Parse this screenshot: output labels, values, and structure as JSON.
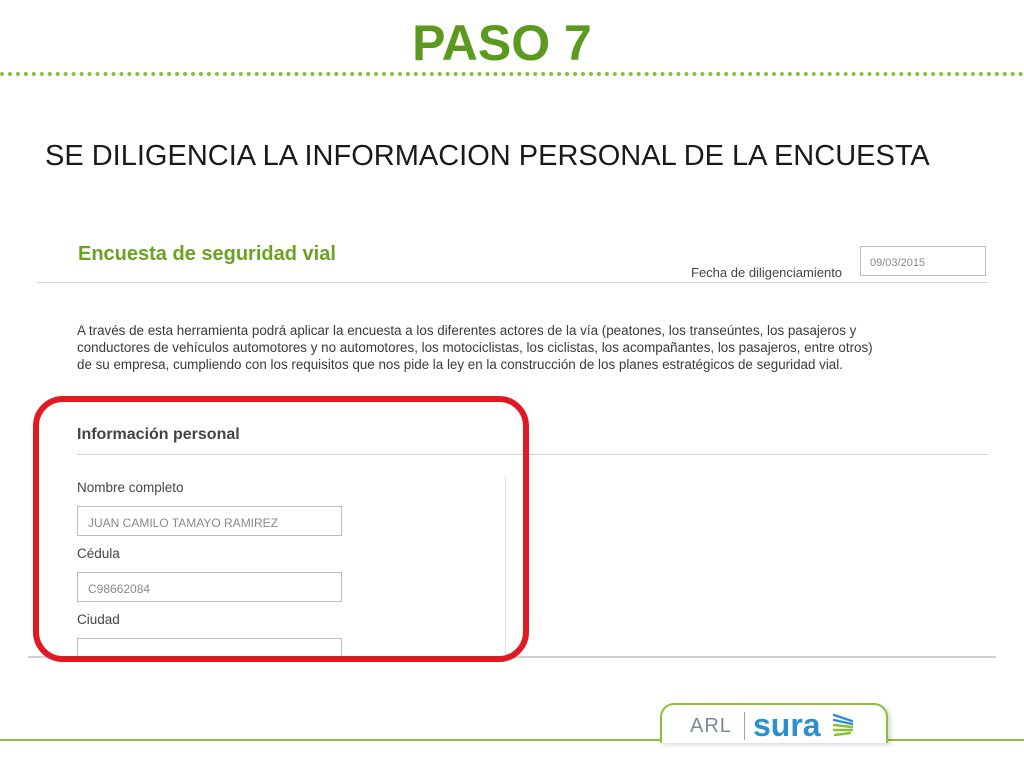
{
  "slide": {
    "title": "PASO 7",
    "subtitle": "SE DILIGENCIA LA INFORMACION PERSONAL DE LA ENCUESTA"
  },
  "form": {
    "title": "Encuesta de seguridad vial",
    "date_value": "09/03/2015",
    "date_label": "Fecha de diligenciamiento",
    "intro_lines": [
      "A través de esta herramienta podrá aplicar la encuesta a los diferentes actores de la vía (peatones, los transeúntes, los pasajeros y",
      "conductores de vehículos automotores y no automotores, los motociclistas, los ciclistas, los acompañantes, los pasajeros, entre otros)",
      "de su empresa, cumpliendo con los requisitos que nos pide la ley en la construcción de los planes estratégicos de seguridad vial."
    ],
    "section_title": "Información personal",
    "fields": {
      "nombre": {
        "label": "Nombre completo",
        "value": "JUAN CAMILO TAMAYO RAMIREZ"
      },
      "cedula": {
        "label": "Cédula",
        "value": "C98662084"
      },
      "ciudad": {
        "label": "Ciudad",
        "value": ""
      }
    }
  },
  "logo": {
    "arl": "ARL",
    "brand": "sura",
    "icon": "sura-wing-icon"
  },
  "colors": {
    "title_green": "#5c9a1f",
    "form_green": "#6aa222",
    "highlight_red": "#e01a22",
    "brand_blue": "#2c8fcf",
    "accent_green": "#8cbf3a"
  }
}
